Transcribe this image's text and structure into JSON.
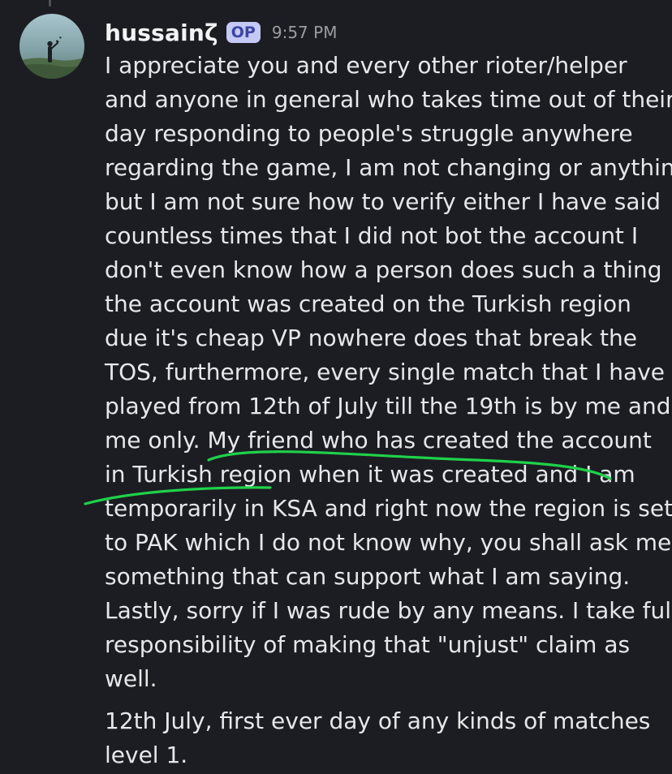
{
  "message": {
    "author": "hussainζ",
    "badge": "OP",
    "time": "9:57 PM",
    "paragraph1_lines": [
      "I appreciate you and every other rioter/helper",
      "and anyone in general who takes time out of their",
      "day responding to people's struggle anywhere",
      "regarding the game, I am not changing or anything",
      "but I am not sure how to verify either I have said",
      "countless times that I did not bot the account I",
      "don't even know how a person does such a thing",
      "the account was created on the Turkish region",
      "due it's cheap VP nowhere does that break the",
      "TOS, furthermore, every single match that I have",
      "played from 12th of July till the 19th is by me and",
      "me only. My friend who has created the account",
      "in Turkish region when it was created and I am",
      "temporarily in KSA and right now the region is set",
      "to PAK which I do not know why, you shall ask me",
      "something that can support what I am saying.",
      "Lastly, sorry if I was rude by any means. I take full",
      "responsibility of making that \"unjust\" claim as",
      "well."
    ],
    "paragraph2_lines": [
      "12th July, first ever day of any kinds of matches",
      "level 1."
    ]
  },
  "colors": {
    "background": "#1c1d22",
    "text": "#e6e7ea",
    "badge_bg": "#c4c9f5",
    "badge_text": "#3c45a5",
    "annotation": "#1fd14a"
  }
}
